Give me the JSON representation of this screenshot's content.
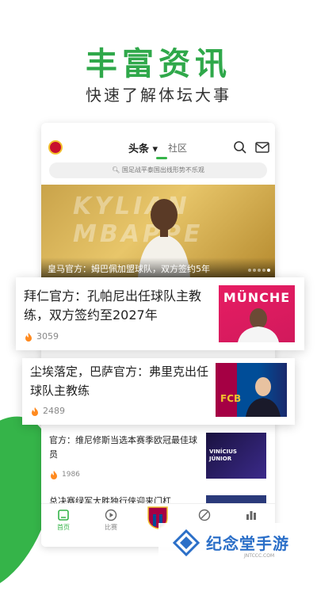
{
  "promo": {
    "headline": "丰富资讯",
    "subline": "快速了解体坛大事"
  },
  "topbar": {
    "tab_headlines": "头条 ▾",
    "tab_community": "社区",
    "search_placeholder": "国足战平泰国出线形势不乐观"
  },
  "hero": {
    "bg_text": "KYLIAN MBAPPE",
    "caption": "皇马官方：姆巴佩加盟球队，双方签约5年"
  },
  "articles": [
    {
      "title": "拜仁官方：孔帕尼出任球队主教练，双方签约至2027年",
      "heat": "3059",
      "thumb_text": "MÜNCHE"
    },
    {
      "title": "尘埃落定，巴萨官方：弗里克出任球队主教练",
      "heat": "2489",
      "thumb_text": "FCB"
    },
    {
      "title": "官方：维尼修斯当选本赛季欧冠最佳球员",
      "heat": "1986",
      "thumb_text": "VINÍCIUS JÚNIOR"
    },
    {
      "title": "总决赛绿军大胜独行侠迎来门杠",
      "heat": ""
    }
  ],
  "bottomnav": {
    "home": "首页",
    "match": "比赛"
  },
  "watermark": {
    "title": "纪念堂手游",
    "sub": "JNTCCC.COM"
  },
  "colors": {
    "brand_green": "#35b449",
    "headline_green": "#2fa84a"
  }
}
